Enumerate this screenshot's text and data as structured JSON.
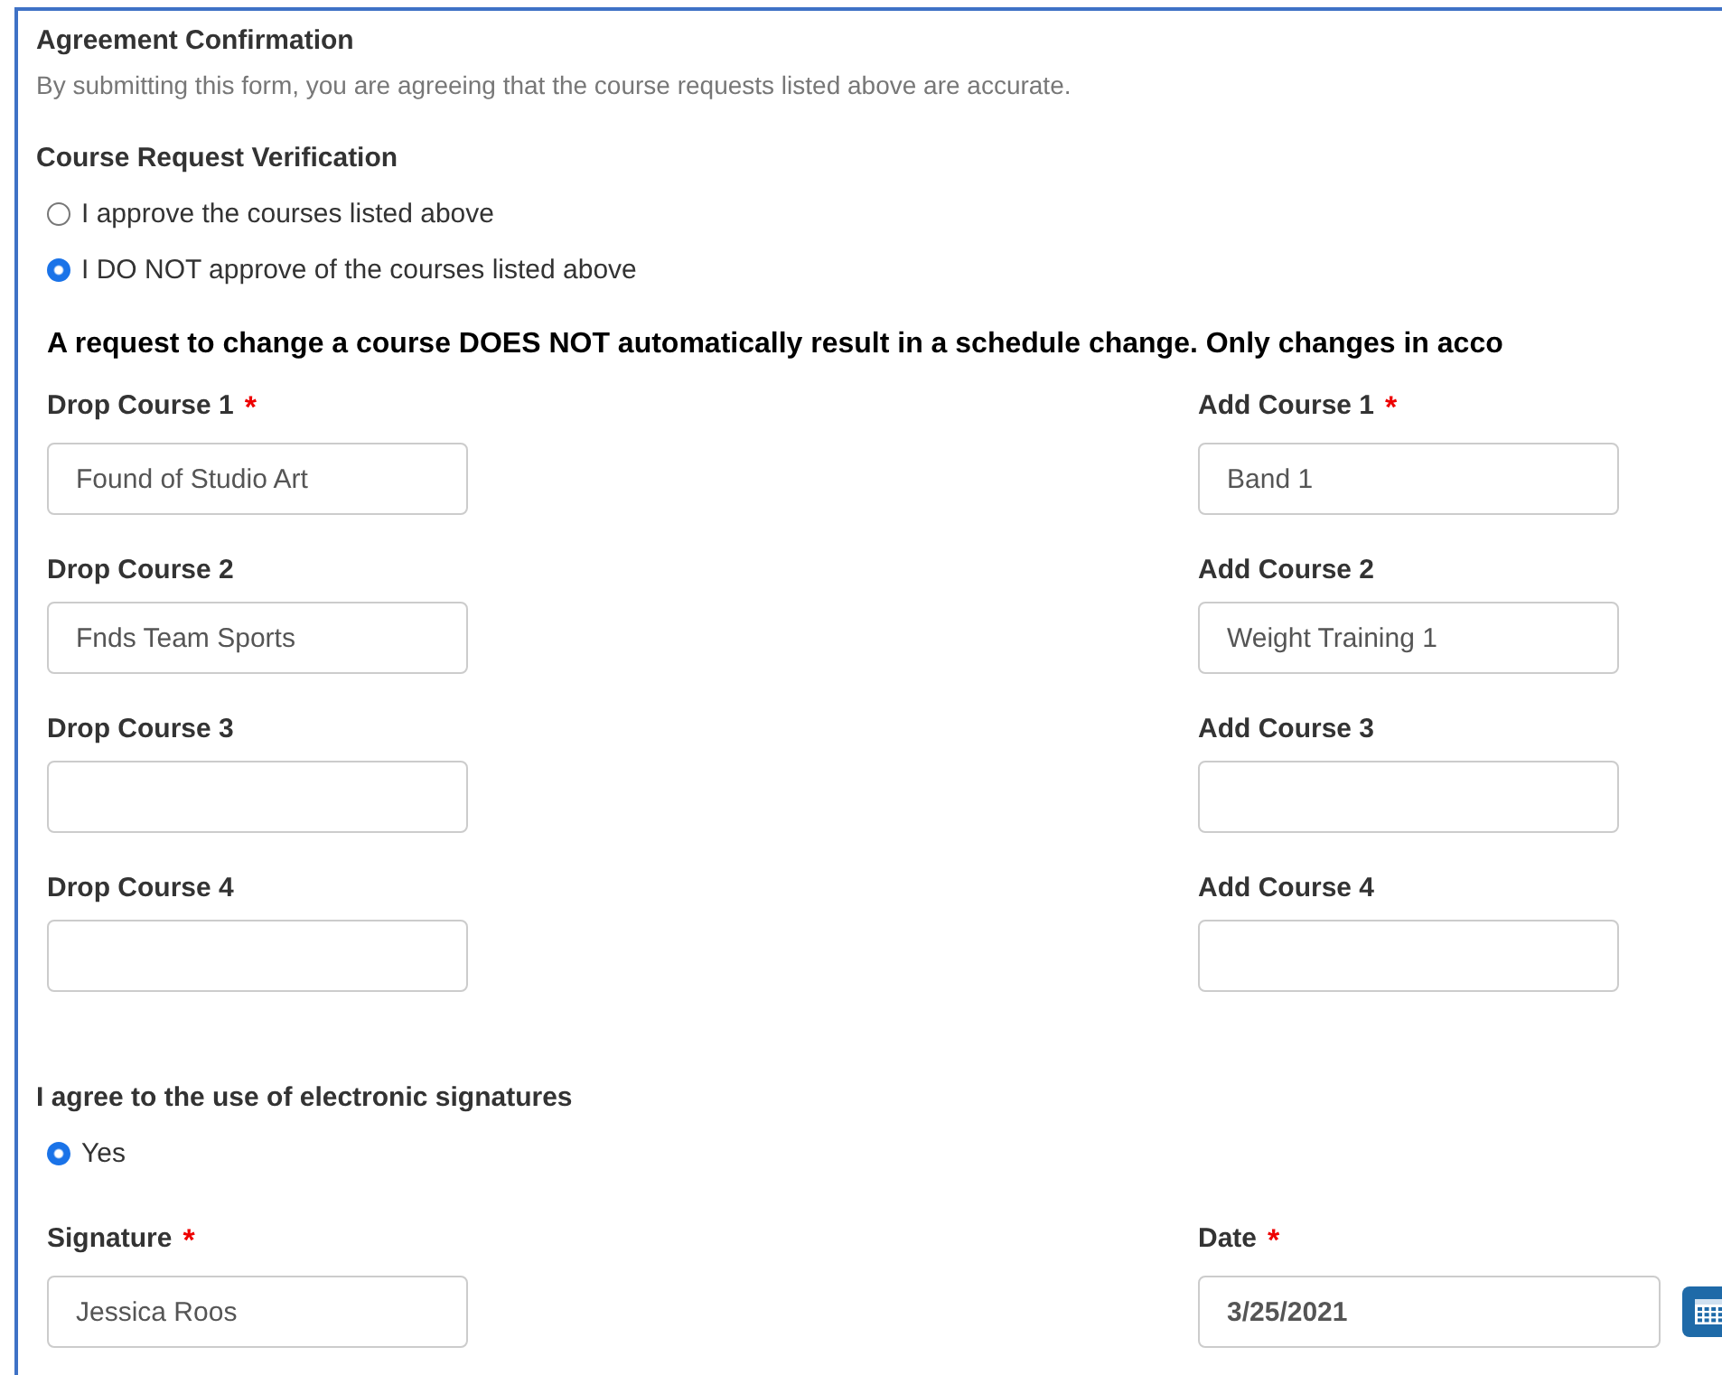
{
  "section": {
    "title": "Agreement Confirmation",
    "description": "By submitting this form, you are agreeing that the course requests listed above are accurate."
  },
  "verification": {
    "title": "Course Request Verification",
    "options": [
      {
        "label": "I approve the courses listed above",
        "selected": false
      },
      {
        "label": "I DO NOT approve of the courses listed above",
        "selected": true
      }
    ]
  },
  "notice": "A request to change a course DOES NOT automatically result in a schedule change. Only changes in acco",
  "course_rows": [
    {
      "drop": {
        "label": "Drop Course 1",
        "required_mark": "*",
        "value": "Found of Studio Art"
      },
      "add": {
        "label": "Add Course 1",
        "required_mark": "*",
        "value": "Band 1"
      }
    },
    {
      "drop": {
        "label": "Drop Course 2",
        "value": "Fnds Team Sports"
      },
      "add": {
        "label": "Add Course 2",
        "value": "Weight Training 1"
      }
    },
    {
      "drop": {
        "label": "Drop Course 3"
      },
      "add": {
        "label": "Add Course 3"
      }
    },
    {
      "drop": {
        "label": "Drop Course 4"
      },
      "add": {
        "label": "Add Course 4"
      }
    }
  ],
  "esignature": {
    "title": "I agree to the use of electronic signatures",
    "options": [
      {
        "label": "Yes",
        "selected": true
      }
    ]
  },
  "signature": {
    "label": "Signature",
    "required_mark": "*",
    "value": "Jessica Roos"
  },
  "date": {
    "label": "Date",
    "required_mark": "*",
    "value": "3/25/2021"
  }
}
